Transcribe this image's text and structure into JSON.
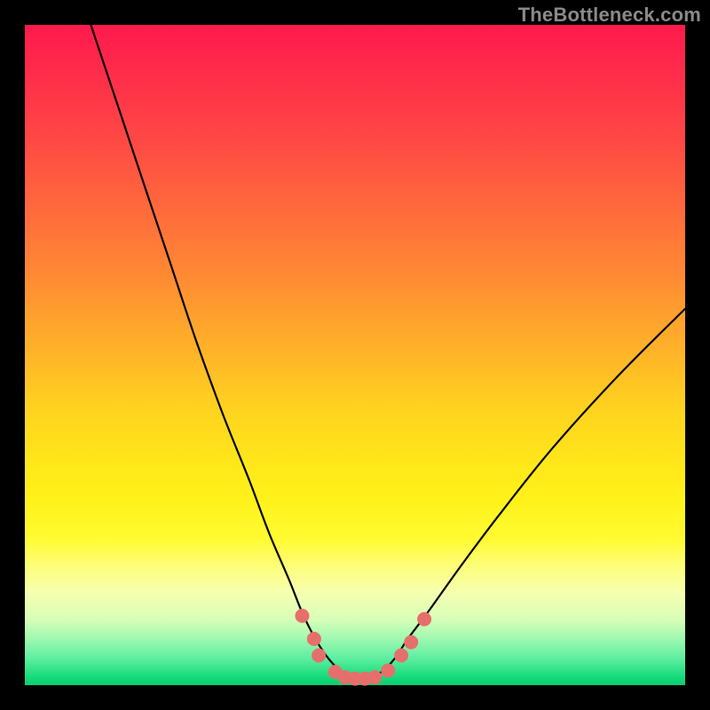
{
  "watermark": "TheBottleneck.com",
  "chart_data": {
    "type": "line",
    "title": "",
    "xlabel": "",
    "ylabel": "",
    "xlim": [
      0,
      100
    ],
    "ylim": [
      0,
      100
    ],
    "grid": false,
    "series": [
      {
        "name": "curve",
        "color": "#000000",
        "x": [
          10,
          14,
          18,
          22,
          26,
          30,
          34,
          37,
          40,
          42,
          44,
          46,
          48,
          50,
          52,
          54,
          56,
          58,
          61,
          66,
          72,
          80,
          90,
          100
        ],
        "y": [
          100,
          88,
          76,
          64,
          52,
          41,
          31,
          23,
          16,
          11,
          7,
          4,
          2,
          1,
          1,
          2,
          4,
          7,
          11,
          18,
          26,
          36,
          47,
          57
        ]
      }
    ],
    "markers": {
      "name": "highlight-dots",
      "color": "#e76f6b",
      "points": [
        {
          "x": 42.0,
          "y": 10.5
        },
        {
          "x": 43.8,
          "y": 7.0
        },
        {
          "x": 44.5,
          "y": 4.5
        },
        {
          "x": 47.0,
          "y": 2.0
        },
        {
          "x": 48.5,
          "y": 1.2
        },
        {
          "x": 50.0,
          "y": 1.0
        },
        {
          "x": 51.5,
          "y": 1.0
        },
        {
          "x": 53.0,
          "y": 1.2
        },
        {
          "x": 55.0,
          "y": 2.2
        },
        {
          "x": 57.0,
          "y": 4.5
        },
        {
          "x": 58.5,
          "y": 6.5
        },
        {
          "x": 60.5,
          "y": 10.0
        }
      ]
    }
  }
}
